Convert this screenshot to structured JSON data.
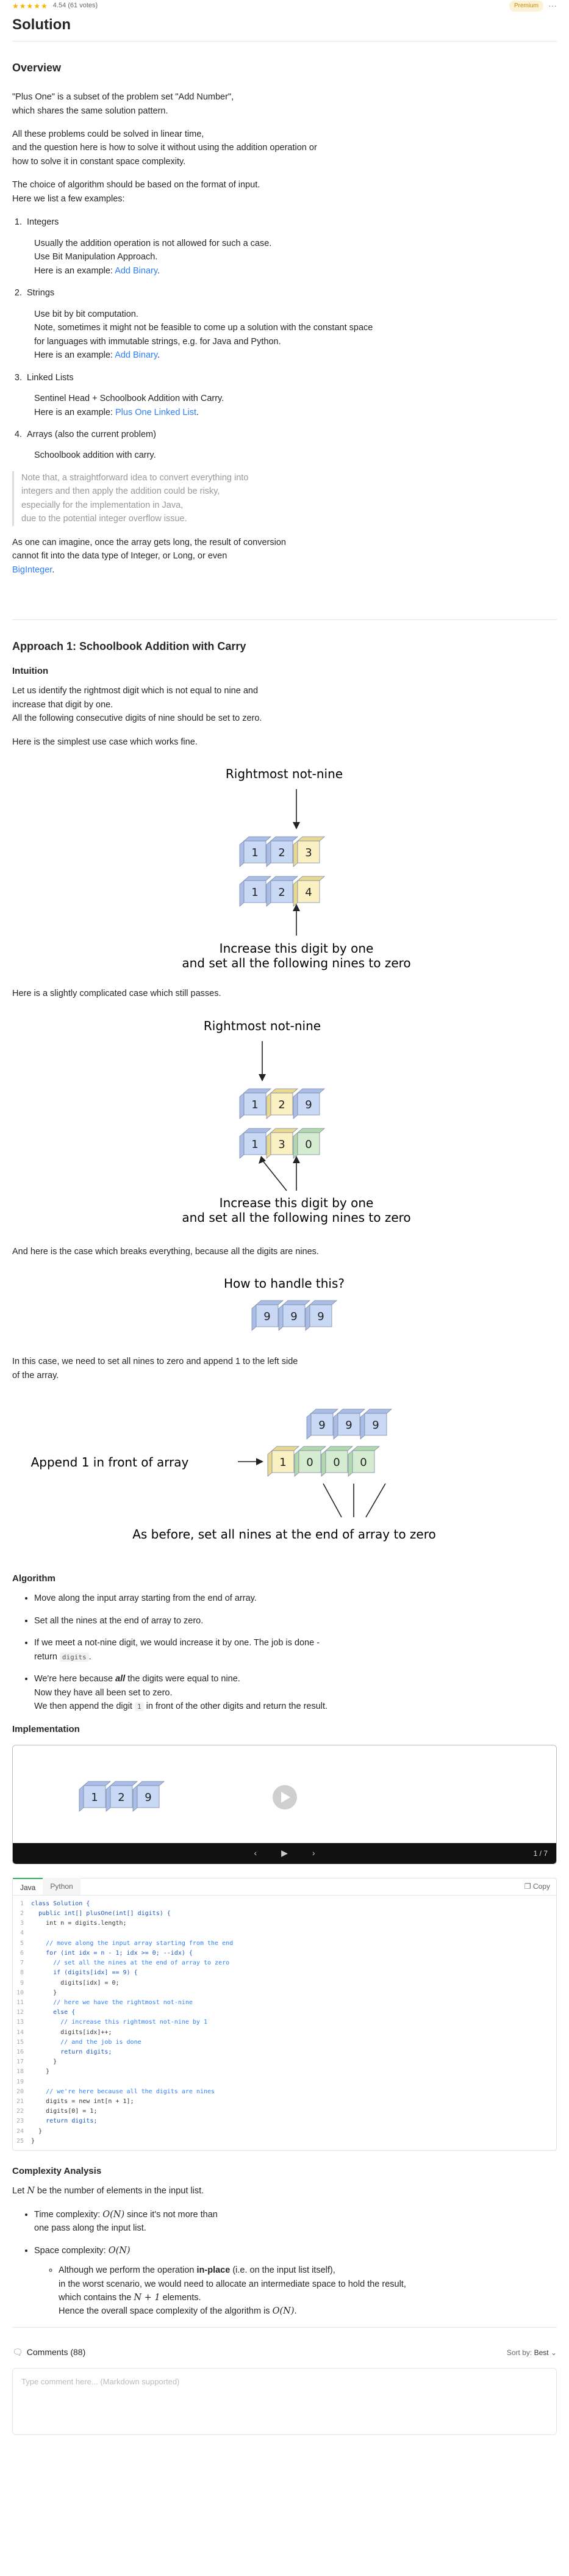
{
  "header": {
    "stars": "★★★★★",
    "rating": "4.54 (61 votes)",
    "premium": "Premium",
    "more": "···",
    "title": "Solution"
  },
  "overview": {
    "heading": "Overview",
    "p1": "\"Plus One\" is a subset of the problem set \"Add Number\",\nwhich shares the same solution pattern.",
    "p2": "All these problems could be solved in linear time,\nand the question here is how to solve it without using the addition operation or\nhow to solve it in constant space complexity.",
    "p3": "The choice of algorithm should be based on the format of input.\nHere we list a few examples:",
    "items": [
      {
        "title": "Integers",
        "body": "Usually the addition operation is not allowed for such a case.\nUse Bit Manipulation Approach.\nHere is an example: ",
        "link": "Add Binary",
        "tail": "."
      },
      {
        "title": "Strings",
        "body": "Use bit by bit computation.\nNote, sometimes it might not be feasible to come up a solution with the constant space\nfor languages with immutable strings, e.g. for Java and Python.\nHere is an example: ",
        "link": "Add Binary",
        "tail": "."
      },
      {
        "title": "Linked Lists",
        "body": "Sentinel Head + Schoolbook Addition with Carry.\nHere is an example: ",
        "link": "Plus One Linked List",
        "tail": "."
      },
      {
        "title": "Arrays (also the current problem)",
        "body": "Schoolbook addition with carry.",
        "link": "",
        "tail": ""
      }
    ],
    "note": "Note that, a straightforward idea to convert everything into\nintegers and then apply the addition could be risky,\nespecially for the implementation in Java,\ndue to the potential integer overflow issue.",
    "p4": "As one can imagine, once the array gets long, the result of conversion\ncannot fit into the data type of Integer, or Long, or even",
    "p4_link": "BigInteger",
    "p4_tail": "."
  },
  "approach": {
    "heading": "Approach 1: Schoolbook Addition with Carry",
    "intuition_heading": "Intuition",
    "p1": "Let us identify the rightmost digit which is not equal to nine and\nincrease that digit by one.\nAll the following consecutive digits of nine should be set to zero.",
    "p2": "Here is the simplest use case which works fine.",
    "fig1": {
      "label_top": "Rightmost not-nine",
      "row1": [
        "1",
        "2",
        "3"
      ],
      "row2": [
        "1",
        "2",
        "4"
      ],
      "label_bottom1": "Increase this digit by one",
      "label_bottom2": "and set all the following nines to zero"
    },
    "p3": "Here is a slightly complicated case which still passes.",
    "fig2": {
      "label_top": "Rightmost not-nine",
      "row1": [
        "1",
        "2",
        "9"
      ],
      "row2": [
        "1",
        "3",
        "0"
      ],
      "label_bottom1": "Increase this digit by one",
      "label_bottom2": "and set all the following nines to zero"
    },
    "p4": "And here is the case which breaks everything, because all the digits are nines.",
    "fig3": {
      "label_top": "How to handle this?",
      "row1": [
        "9",
        "9",
        "9"
      ]
    },
    "p5": "In this case, we need to set all nines to zero and append 1 to the left side\nof the array.",
    "fig4": {
      "row1": [
        "9",
        "9",
        "9"
      ],
      "row2": [
        "1",
        "0",
        "0",
        "0"
      ],
      "label_left": "Append 1 in front of array",
      "label_bottom": "As before, set all nines at the end of array to zero"
    },
    "algorithm_heading": "Algorithm",
    "alg": [
      {
        "text": "Move along the input array starting from the end of array."
      },
      {
        "text": "Set all the nines at the end of array to zero."
      },
      {
        "text": "If we meet a not-nine digit, we would increase it by one. The job is done -\nreturn ",
        "code": "digits",
        "tail": "."
      },
      {
        "pre": "We're here because ",
        "em": "all",
        "text": " the digits were equal to nine.\nNow they have all been set to zero.\nWe then append the digit ",
        "code": "1",
        "tail": " in front of the other digits and return the result."
      }
    ],
    "implementation_heading": "Implementation",
    "player": {
      "cells": [
        "1",
        "2",
        "9"
      ],
      "prev": "‹",
      "play": "▶",
      "next": "›",
      "counter": "1 / 7"
    },
    "code_tabs": [
      "Java",
      "Python"
    ],
    "copy_label": "Copy",
    "code": [
      "class Solution {",
      "  public int[] plusOne(int[] digits) {",
      "    int n = digits.length;",
      "",
      "    // move along the input array starting from the end",
      "    for (int idx = n - 1; idx >= 0; --idx) {",
      "      // set all the nines at the end of array to zero",
      "      if (digits[idx] == 9) {",
      "        digits[idx] = 0;",
      "      }",
      "      // here we have the rightmost not-nine",
      "      else {",
      "        // increase this rightmost not-nine by 1",
      "        digits[idx]++;",
      "        // and the job is done",
      "        return digits;",
      "      }",
      "    }",
      "",
      "    // we're here because all the digits are nines",
      "    digits = new int[n + 1];",
      "    digits[0] = 1;",
      "    return digits;",
      "  }",
      "}"
    ]
  },
  "complexity": {
    "heading": "Complexity Analysis",
    "intro_pre": "Let ",
    "intro_math": "N",
    "intro_post": " be the number of elements in the input list.",
    "time_pre": "Time complexity: ",
    "time_math": "O(N)",
    "time_post": " since it's not more than\none pass along the input list.",
    "space_pre": "Space complexity: ",
    "space_math": "O(N)",
    "sub_pre": "Although we perform the operation ",
    "sub_bold": "in-place",
    "sub_mid": " (i.e. on the input list itself),\nin the worst scenario, we would need to allocate an intermediate space to hold the result,\nwhich contains the ",
    "sub_math": "N + 1",
    "sub_mid2": " elements.\nHence the overall space complexity of the algorithm is ",
    "sub_math2": "O(N)",
    "sub_tail": "."
  },
  "comments": {
    "label": "Comments (88)",
    "sort": "Sort by:",
    "sort_value": "Best",
    "placeholder": "Type comment here... (Markdown supported)"
  },
  "colors": {
    "blue": "#c9d9f5",
    "yellow": "#fbf0c2",
    "green": "#d5ecd0",
    "link": "#2d7ff9"
  }
}
